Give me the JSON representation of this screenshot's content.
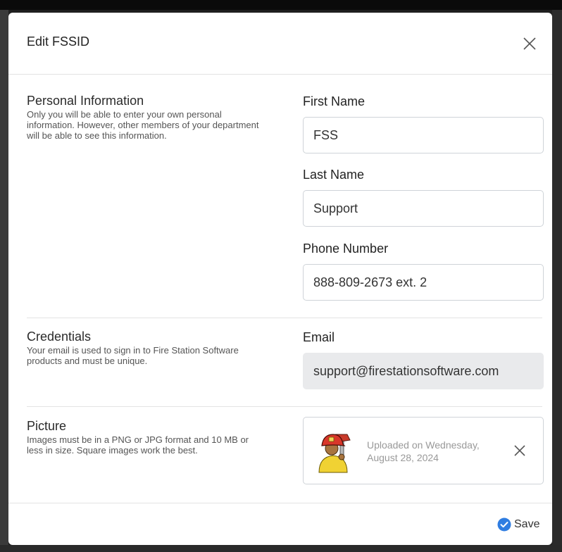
{
  "modal": {
    "title": "Edit FSSID"
  },
  "personal": {
    "title": "Personal Information",
    "description": "Only you will be able to enter your own personal information. However, other members of your department will be able to see this information.",
    "first_name_label": "First Name",
    "first_name_value": "FSS",
    "last_name_label": "Last Name",
    "last_name_value": "Support",
    "phone_label": "Phone Number",
    "phone_value": "888-809-2673 ext. 2"
  },
  "credentials": {
    "title": "Credentials",
    "description": "Your email is used to sign in to Fire Station Software products and must be unique.",
    "email_label": "Email",
    "email_value": "support@firestationsoftware.com"
  },
  "picture": {
    "title": "Picture",
    "description": "Images must be in a PNG or JPG format and 10 MB or less in size. Square images work the best.",
    "uploaded_text": "Uploaded on Wednesday, August 28, 2024",
    "avatar_icon": "firefighter-avatar-icon"
  },
  "footer": {
    "save_label": "Save",
    "accent_color": "#2f7de1"
  }
}
